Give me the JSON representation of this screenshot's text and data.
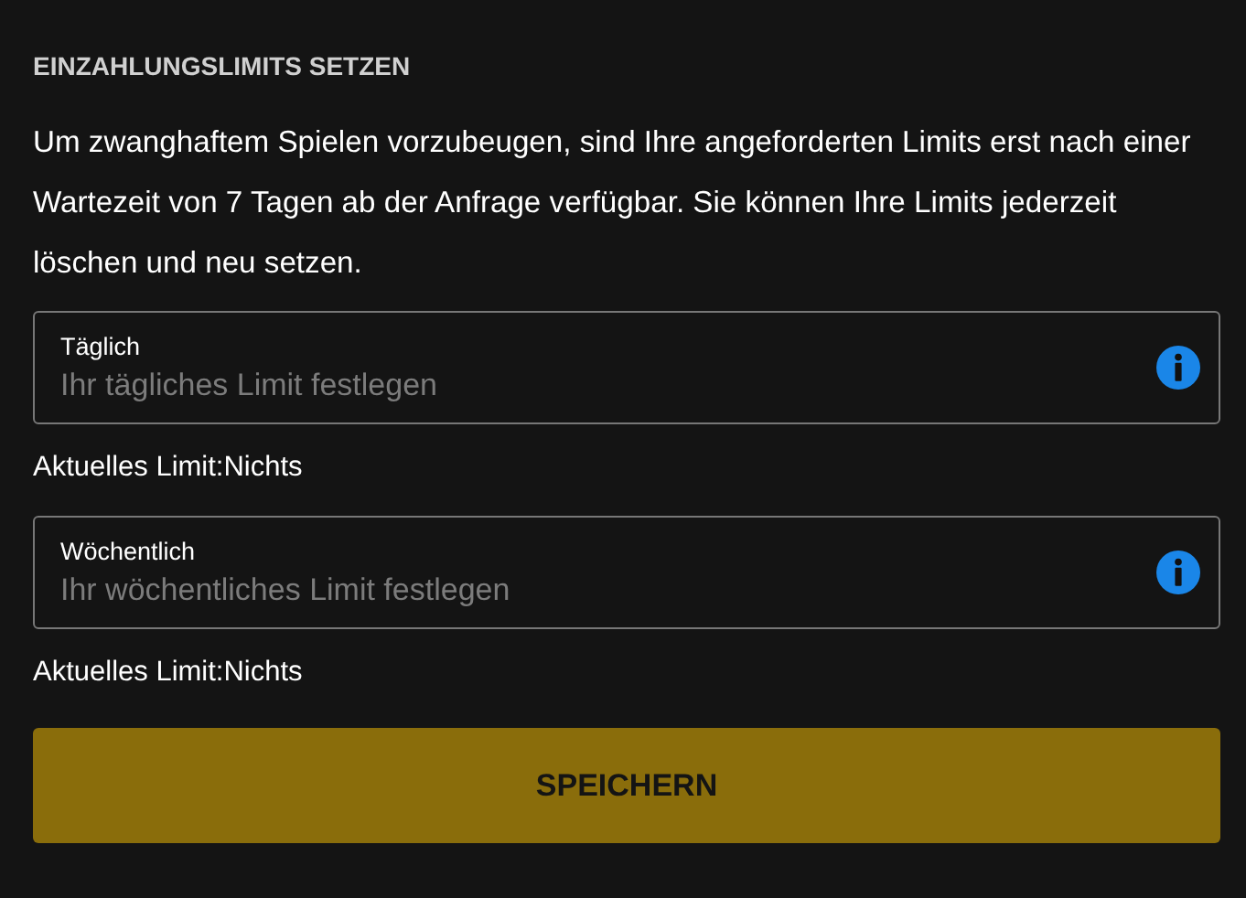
{
  "heading": "EINZAHLUNGSLIMITS SETZEN",
  "intro": "Um zwanghaftem Spielen vorzubeugen, sind Ihre angeforderten Limits erst nach einer Wartezeit von 7 Tagen ab der Anfrage verfügbar. Sie können Ihre Limits jederzeit löschen und neu setzen.",
  "fields": [
    {
      "label": "Täglich",
      "placeholder": "Ihr tägliches Limit festlegen",
      "current_limit": "Aktuelles Limit:Nichts"
    },
    {
      "label": "Wöchentlich",
      "placeholder": "Ihr wöchentliches Limit festlegen",
      "current_limit": "Aktuelles Limit:Nichts"
    }
  ],
  "button": "SPEICHERN"
}
